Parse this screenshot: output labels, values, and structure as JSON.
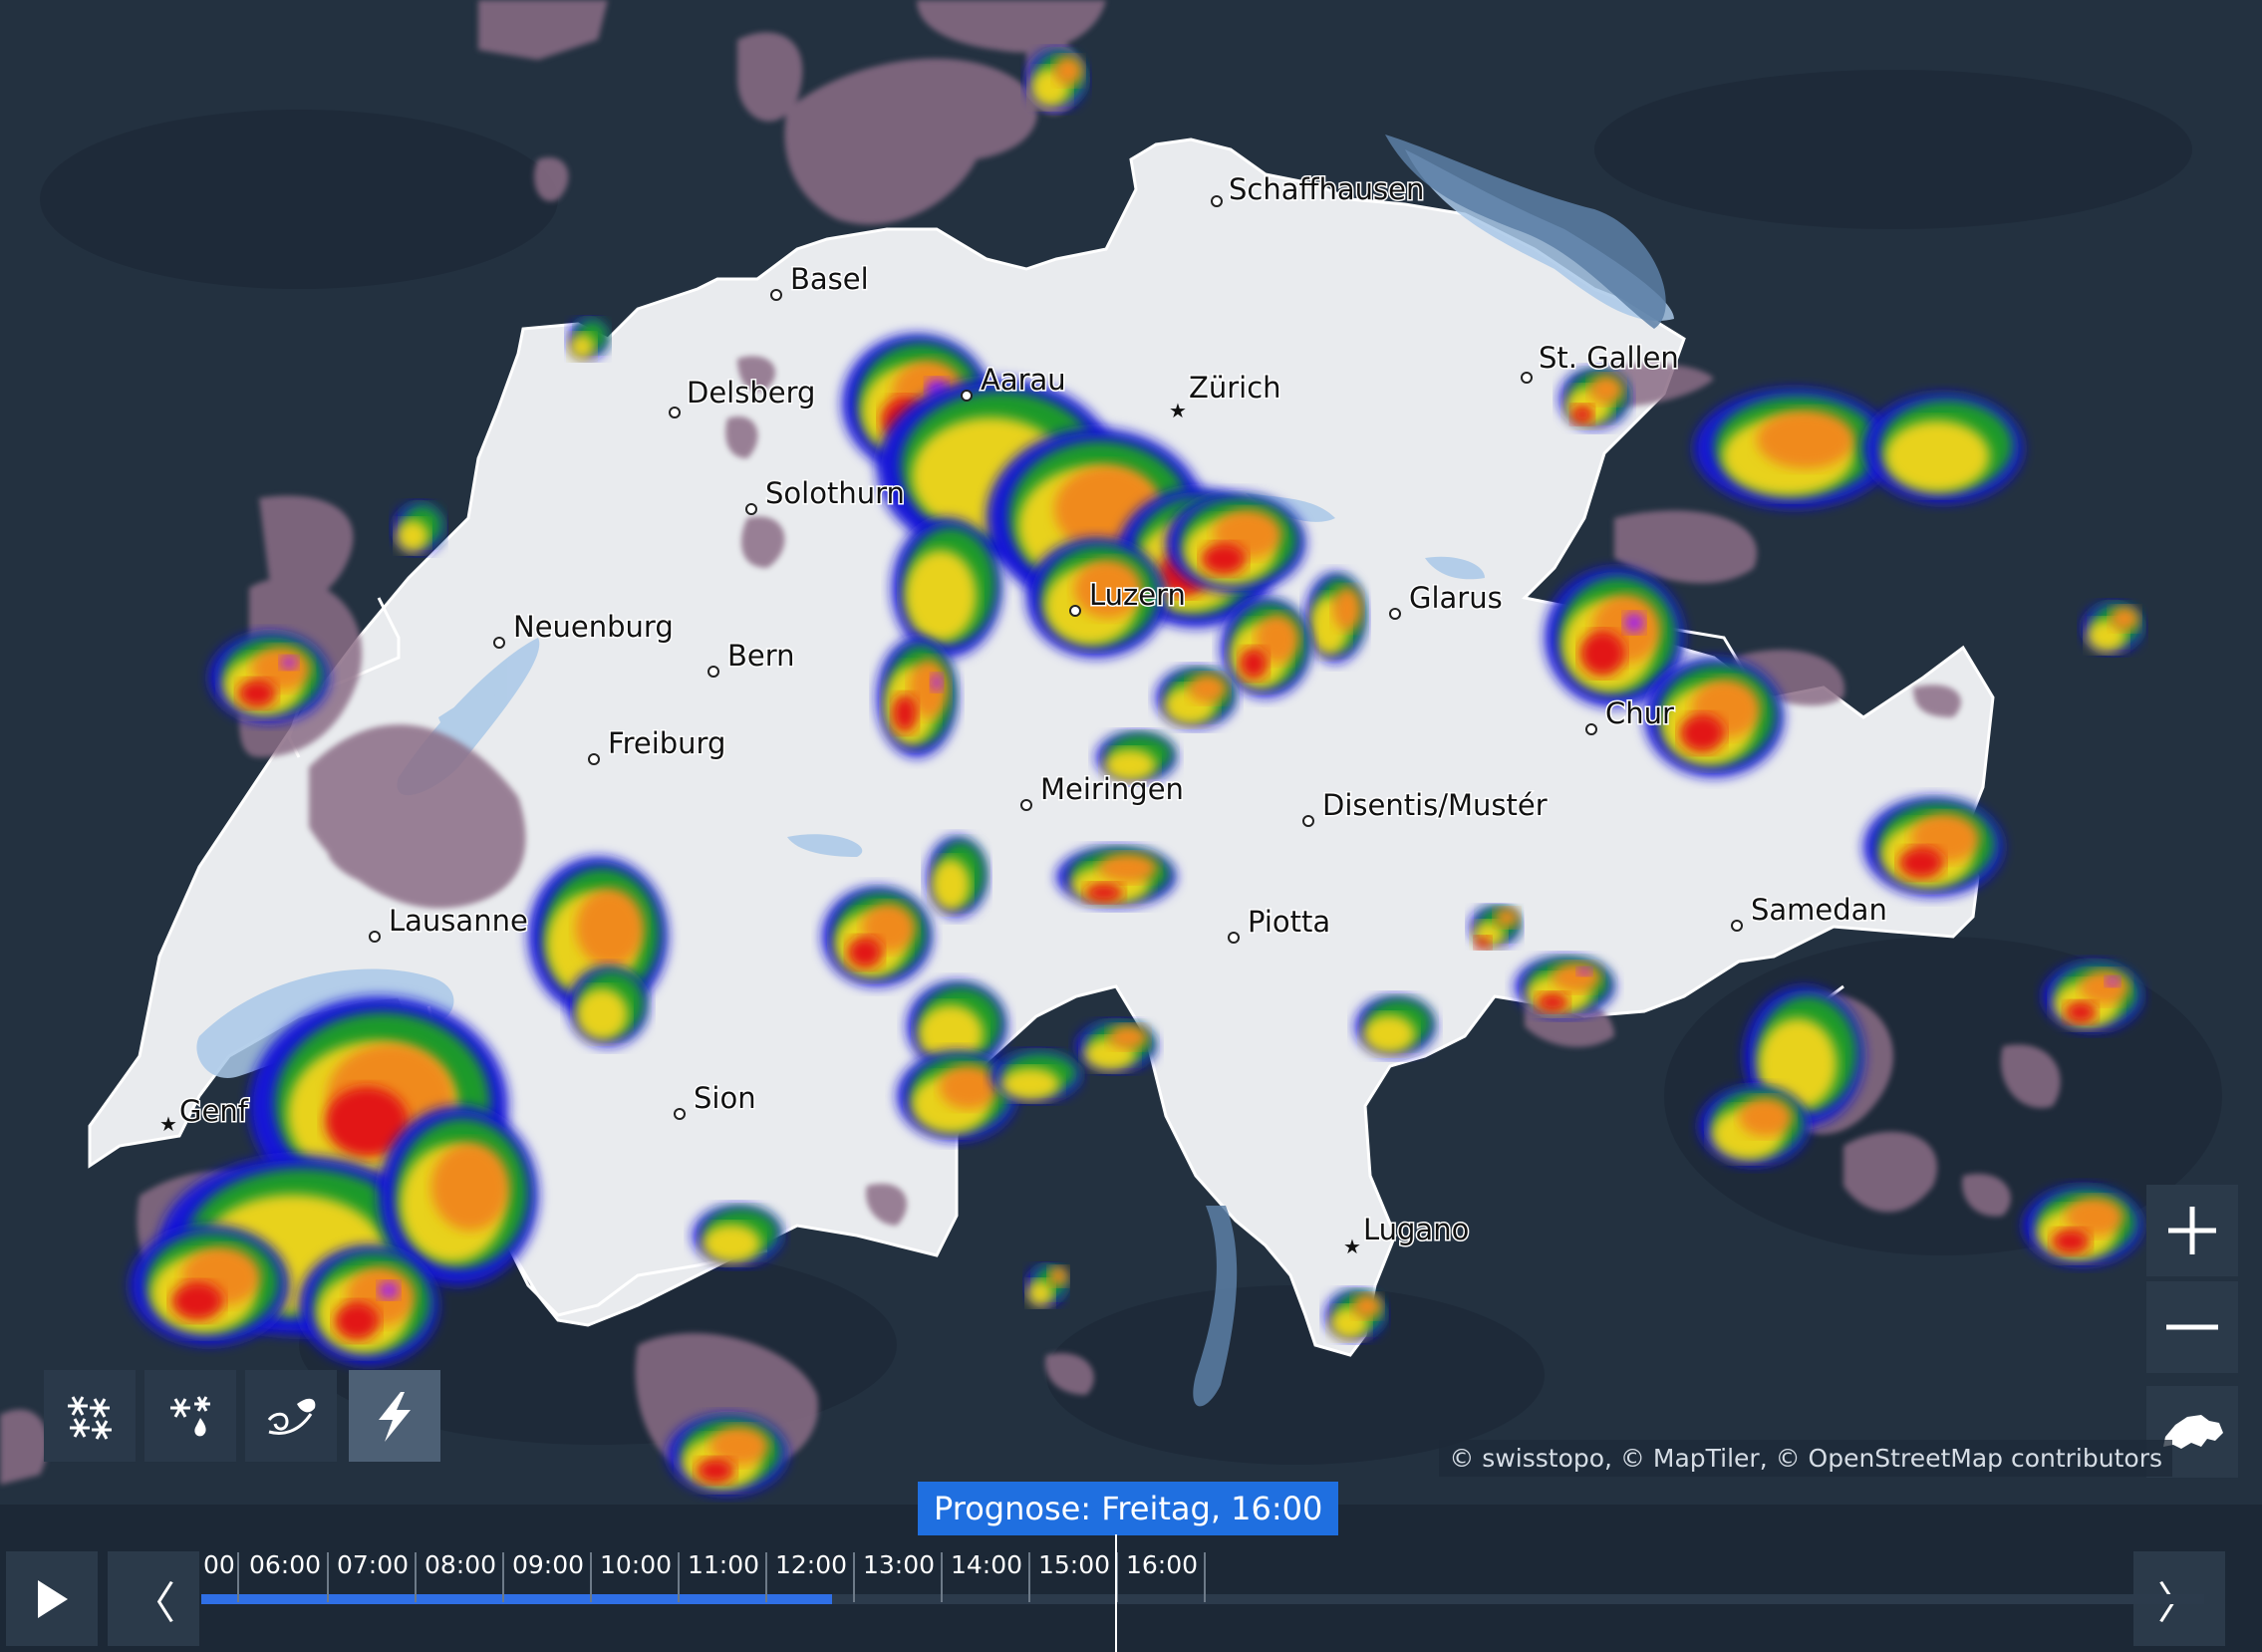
{
  "map": {
    "cities": [
      {
        "name": "Schaffhausen",
        "marker": "dot"
      },
      {
        "name": "Basel",
        "marker": "dot"
      },
      {
        "name": "Delsberg",
        "marker": "dot"
      },
      {
        "name": "Aarau",
        "marker": "dot"
      },
      {
        "name": "Zürich",
        "marker": "star"
      },
      {
        "name": "St. Gallen",
        "marker": "dot"
      },
      {
        "name": "Solothurn",
        "marker": "dot"
      },
      {
        "name": "Neuenburg",
        "marker": "dot"
      },
      {
        "name": "Bern",
        "marker": "dot"
      },
      {
        "name": "Luzern",
        "marker": "dot"
      },
      {
        "name": "Glarus",
        "marker": "dot"
      },
      {
        "name": "Freiburg",
        "marker": "dot"
      },
      {
        "name": "Chur",
        "marker": "dot"
      },
      {
        "name": "Meiringen",
        "marker": "dot"
      },
      {
        "name": "Disentis/Mustér",
        "marker": "dot"
      },
      {
        "name": "Lausanne",
        "marker": "dot"
      },
      {
        "name": "Piotta",
        "marker": "dot"
      },
      {
        "name": "Samedan",
        "marker": "dot"
      },
      {
        "name": "Genf",
        "marker": "star"
      },
      {
        "name": "Sion",
        "marker": "dot"
      },
      {
        "name": "Lugano",
        "marker": "star"
      }
    ],
    "attribution": "© swisstopo, © MapTiler, © OpenStreetMap contributors",
    "colors": {
      "background": "#233140",
      "country": "#e9ebee",
      "lakes": "#a9c8e8",
      "light_precip": "#8b6d86",
      "blue": "#1414d8",
      "green": "#1f9a2a",
      "yellow": "#e8d21c",
      "orange": "#f08a1c",
      "red": "#e21616",
      "violet": "#a020f0"
    }
  },
  "controls": {
    "zoom_in": "plus-icon",
    "zoom_out": "minus-icon",
    "reset": "switzerland-icon"
  },
  "layers": [
    {
      "icon": "snow-icon",
      "active": false
    },
    {
      "icon": "sleet-icon",
      "active": false
    },
    {
      "icon": "wind-icon",
      "active": false
    },
    {
      "icon": "lightning-icon",
      "active": true
    }
  ],
  "timeline": {
    "label": "Prognose: Freitag, 16:00",
    "partial_label": "00",
    "ticks": [
      "06:00",
      "07:00",
      "08:00",
      "09:00",
      "10:00",
      "11:00",
      "12:00",
      "13:00",
      "14:00",
      "15:00",
      "16:00"
    ],
    "progress": 0.315,
    "play_icon": "play-icon",
    "prev_icon": "chevron-left-icon",
    "next_icon": "chevron-right-icon",
    "prev_glyph": "〈",
    "next_glyph": "〉"
  }
}
